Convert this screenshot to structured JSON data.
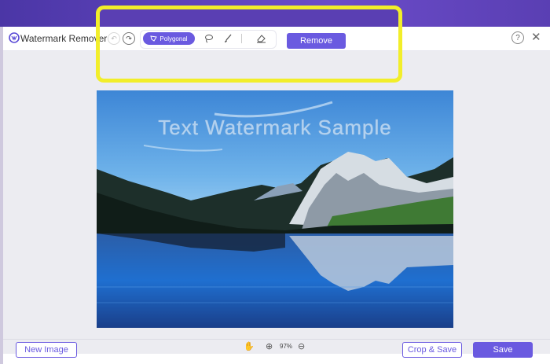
{
  "app": {
    "title": "Watermark Remover"
  },
  "toolbar": {
    "polygonal_label": "Polygonal",
    "remove_label": "Remove",
    "help_symbol": "?",
    "close_symbol": "✕"
  },
  "image": {
    "watermark_text": "Text Watermark Sample"
  },
  "zoom": {
    "value": "97%"
  },
  "footer": {
    "new_image_label": "New Image",
    "crop_save_label": "Crop & Save",
    "save_label": "Save"
  },
  "colors": {
    "accent": "#6a5ae0",
    "highlight": "#f2ee2a",
    "banner": "#5a3fb3"
  },
  "icons": [
    "app-logo-icon",
    "undo-icon",
    "redo-icon",
    "polygonal-icon",
    "lasso-icon",
    "brush-icon",
    "eraser-icon",
    "help-icon",
    "close-icon",
    "hand-icon",
    "zoom-in-icon",
    "zoom-out-icon"
  ]
}
